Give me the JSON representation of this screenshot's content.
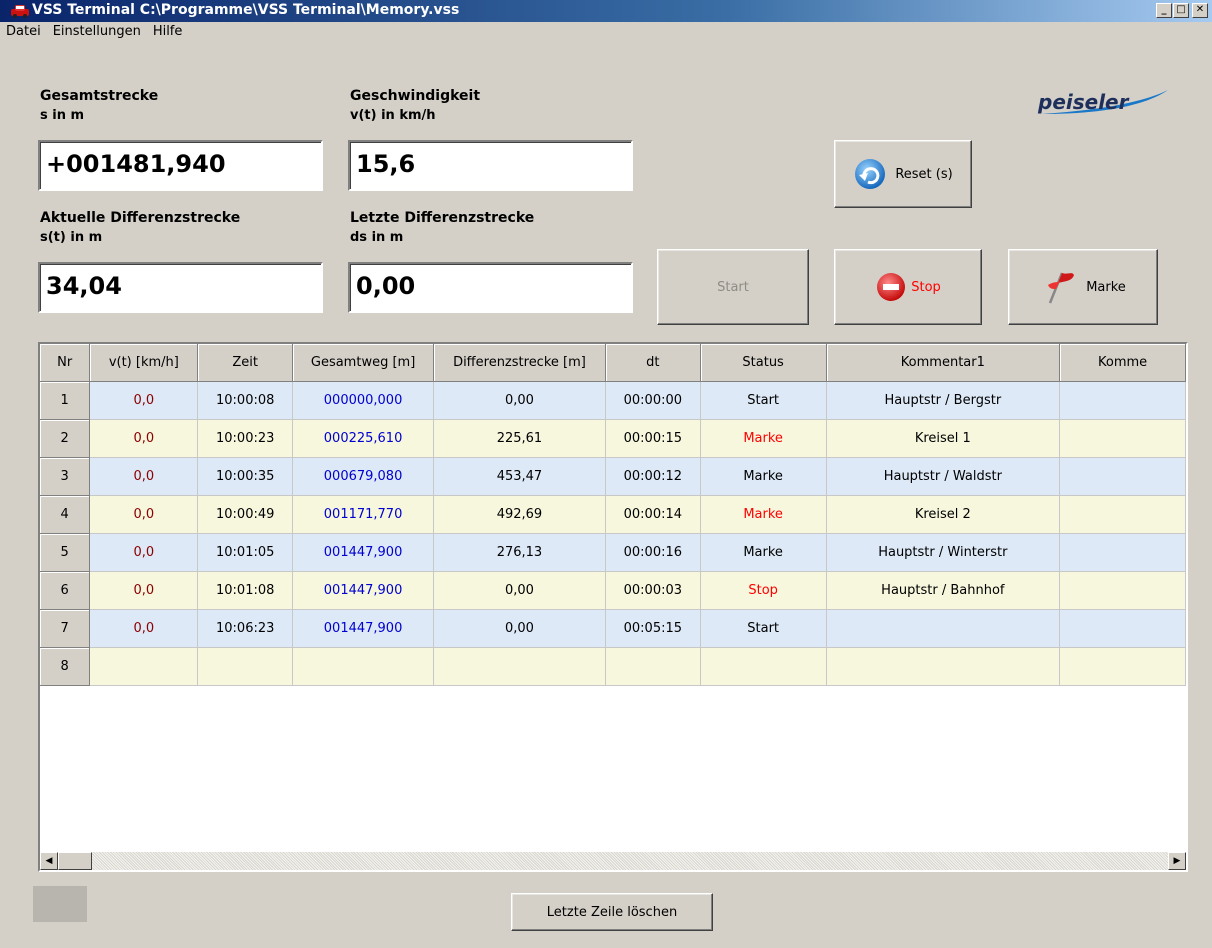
{
  "window": {
    "title": "VSS Terminal  C:\\Programme\\VSS Terminal\\Memory.vss",
    "minimize": "_",
    "maximize": "□",
    "close": "✕"
  },
  "menu": [
    "Datei",
    "Einstellungen",
    "Hilfe"
  ],
  "fields": {
    "gesamt_label": "Gesamtstrecke",
    "gesamt_unit": "s in m",
    "gesamt_value": "+001481,940",
    "speed_label": "Geschwindigkeit",
    "speed_unit": "v(t) in km/h",
    "speed_value": "15,6",
    "akt_label": "Aktuelle Differenzstrecke",
    "akt_unit": "s(t) in m",
    "akt_value": "34,04",
    "letzte_label": "Letzte Differenzstrecke",
    "letzte_unit": "ds in m",
    "letzte_value": "0,00"
  },
  "logo": "peiseler",
  "buttons": {
    "reset": "Reset (s)",
    "start": "Start",
    "stop": "Stop",
    "marke": "Marke",
    "delete_last": "Letzte Zeile löschen"
  },
  "grid": {
    "headers": [
      "Nr",
      "v(t) [km/h]",
      "Zeit",
      "Gesamtweg [m]",
      "Differenzstrecke [m]",
      "dt",
      "Status",
      "Kommentar1",
      "Komme"
    ],
    "rows": [
      {
        "nr": "1",
        "v": "0,0",
        "zeit": "10:00:08",
        "gesamt": "000000,000",
        "diff": "0,00",
        "dt": "00:00:00",
        "status": "Start",
        "kommentar": "Hauptstr / Bergstr",
        "red": false
      },
      {
        "nr": "2",
        "v": "0,0",
        "zeit": "10:00:23",
        "gesamt": "000225,610",
        "diff": "225,61",
        "dt": "00:00:15",
        "status": "Marke",
        "kommentar": "Kreisel 1",
        "red": true
      },
      {
        "nr": "3",
        "v": "0,0",
        "zeit": "10:00:35",
        "gesamt": "000679,080",
        "diff": "453,47",
        "dt": "00:00:12",
        "status": "Marke",
        "kommentar": "Hauptstr / Waldstr",
        "red": false
      },
      {
        "nr": "4",
        "v": "0,0",
        "zeit": "10:00:49",
        "gesamt": "001171,770",
        "diff": "492,69",
        "dt": "00:00:14",
        "status": "Marke",
        "kommentar": "Kreisel 2",
        "red": true
      },
      {
        "nr": "5",
        "v": "0,0",
        "zeit": "10:01:05",
        "gesamt": "001447,900",
        "diff": "276,13",
        "dt": "00:00:16",
        "status": "Marke",
        "kommentar": "Hauptstr / Winterstr",
        "red": false
      },
      {
        "nr": "6",
        "v": "0,0",
        "zeit": "10:01:08",
        "gesamt": "001447,900",
        "diff": "0,00",
        "dt": "00:00:03",
        "status": "Stop",
        "kommentar": "Hauptstr / Bahnhof",
        "red": true
      },
      {
        "nr": "7",
        "v": "0,0",
        "zeit": "10:06:23",
        "gesamt": "001447,900",
        "diff": "0,00",
        "dt": "00:05:15",
        "status": "Start",
        "kommentar": "",
        "red": false
      },
      {
        "nr": "8",
        "v": "",
        "zeit": "",
        "gesamt": "",
        "diff": "",
        "dt": "",
        "status": "",
        "kommentar": "",
        "red": false
      }
    ]
  },
  "scroll": {
    "left": "◀",
    "right": "▶"
  },
  "colors": {
    "row_odd": "#dde9f7",
    "row_even": "#f7f7de",
    "speed_text": "#8b0000",
    "total_text": "#0000d0",
    "status_red": "#ff0000"
  }
}
